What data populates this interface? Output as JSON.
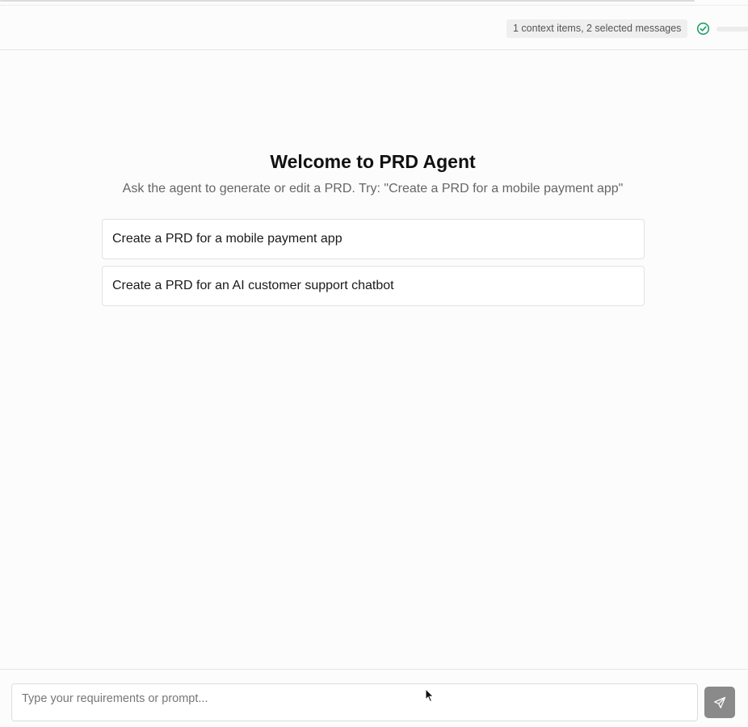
{
  "header": {
    "context_summary": "1 context items, 2 selected messages",
    "status_icon": "check-circle-icon",
    "status_color": "#22a06b"
  },
  "welcome": {
    "title": "Welcome to PRD Agent",
    "subtitle": "Ask the agent to generate or edit a PRD. Try: \"Create a PRD for a mobile payment app\""
  },
  "suggestions": [
    {
      "label": "Create a PRD for a mobile payment app"
    },
    {
      "label": "Create a PRD for an AI customer support chatbot"
    }
  ],
  "composer": {
    "value": "",
    "placeholder": "Type your requirements or prompt...",
    "send_icon": "send-icon",
    "send_button_color": "#8a8a8a"
  }
}
